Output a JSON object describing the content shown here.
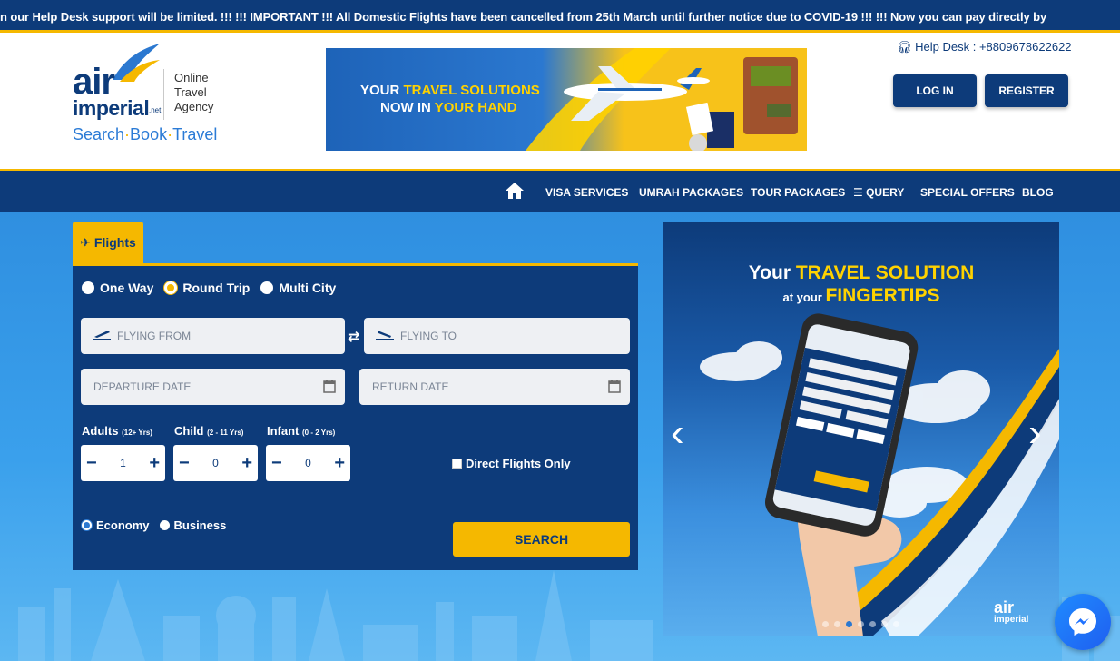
{
  "ticker": {
    "text": "n our Help Desk support will be limited. !!!      !!! IMPORTANT !!! All Domestic Flights have been cancelled from 25th March until further notice due to COVID-19 !!!      !!! Now you can pay directly by"
  },
  "header": {
    "logo_air": "air",
    "logo_imperial": "imperial",
    "logo_net": ".net",
    "logo_tag_1": "Online",
    "logo_tag_2": "Travel",
    "logo_tag_3": "Agency",
    "slogan_1": "Search",
    "slogan_2": "Book",
    "slogan_3": "Travel",
    "banner_line1_a": "YOUR ",
    "banner_line1_b": "TRAVEL SOLUTIONS",
    "banner_line2_a": "NOW IN ",
    "banner_line2_b": "YOUR HAND",
    "helpdesk": "Help Desk : +8809678622622",
    "login_label": "LOG IN",
    "register_label": "REGISTER"
  },
  "nav": {
    "items": [
      "VISA SERVICES",
      "UMRAH PACKAGES",
      "TOUR PACKAGES",
      "QUERY",
      "SPECIAL OFFERS",
      "BLOG"
    ]
  },
  "search": {
    "tab_label": "Flights",
    "trip_types": [
      "One Way",
      "Round Trip",
      "Multi City"
    ],
    "trip_selected": "Round Trip",
    "from_placeholder": "FLYING FROM",
    "to_placeholder": "FLYING TO",
    "departure_placeholder": "DEPARTURE DATE",
    "return_placeholder": "RETURN DATE",
    "adults_label": "Adults",
    "adults_range": "(12+ Yrs)",
    "adults_value": "1",
    "child_label": "Child",
    "child_range": "(2 - 11 Yrs)",
    "child_value": "0",
    "infant_label": "Infant",
    "infant_range": "(0 - 2 Yrs)",
    "infant_value": "0",
    "direct_label": "Direct Flights Only",
    "class_economy": "Economy",
    "class_business": "Business",
    "class_selected": "Economy",
    "search_label": "SEARCH"
  },
  "promo": {
    "line1_a": "Your ",
    "line1_b": "TRAVEL SOLUTION",
    "line2_a": "at your ",
    "line2_b": "FINGERTIPS",
    "logo_air": "air",
    "logo_imperial": "imperial",
    "slides_total": 7,
    "slide_active": 3
  },
  "colors": {
    "navy": "#0d3b7a",
    "yellow": "#f5b800",
    "sky": "#3aa0ec"
  }
}
